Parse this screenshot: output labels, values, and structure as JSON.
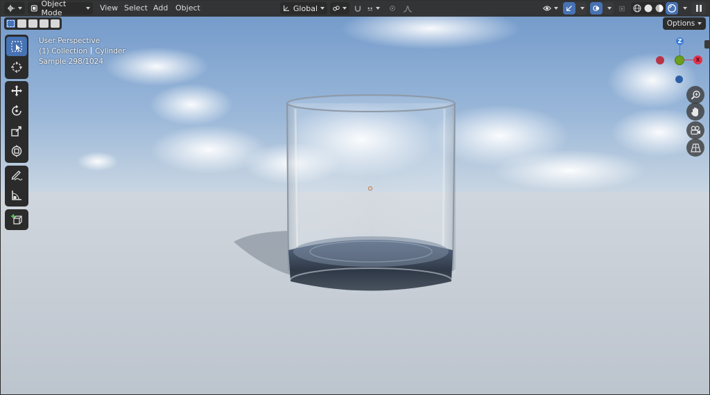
{
  "header": {
    "mode": "Object Mode",
    "menus": [
      "View",
      "Select",
      "Add",
      "Object"
    ],
    "transform_orientation": "Global"
  },
  "overlay": {
    "line1": "User Perspective",
    "collection": "(1) Collection",
    "object": "Cylinder",
    "sample": "Sample 298/1024"
  },
  "options_label": "Options",
  "gizmo": {
    "z_label": "Z",
    "x_label": "X"
  },
  "icons": {
    "header": [
      "editor-type-icon",
      "object-mode-icon",
      "orientation-icon",
      "pivot-icon",
      "snap-magnet-icon",
      "snap-target-icon",
      "proportional-icon",
      "falloff-icon",
      "visibility-icon",
      "gizmo-icon",
      "overlay-icon",
      "xray-icon",
      "shading-wireframe-icon",
      "shading-solid-icon",
      "shading-material-icon",
      "shading-rendered-icon",
      "pause-icon"
    ],
    "tools": [
      "select-box-icon",
      "cursor-icon",
      "move-icon",
      "rotate-icon",
      "scale-icon",
      "transform-icon",
      "annotate-icon",
      "measure-icon",
      "add-cube-icon"
    ],
    "nav": [
      "zoom-icon",
      "pan-hand-icon",
      "camera-icon",
      "grid-perspective-icon"
    ]
  },
  "colors": {
    "accent": "#4772b3",
    "header_bg": "#303030",
    "axis_x": "#e0344d",
    "axis_y": "#6b9e1f",
    "axis_z": "#3d7dd8"
  }
}
